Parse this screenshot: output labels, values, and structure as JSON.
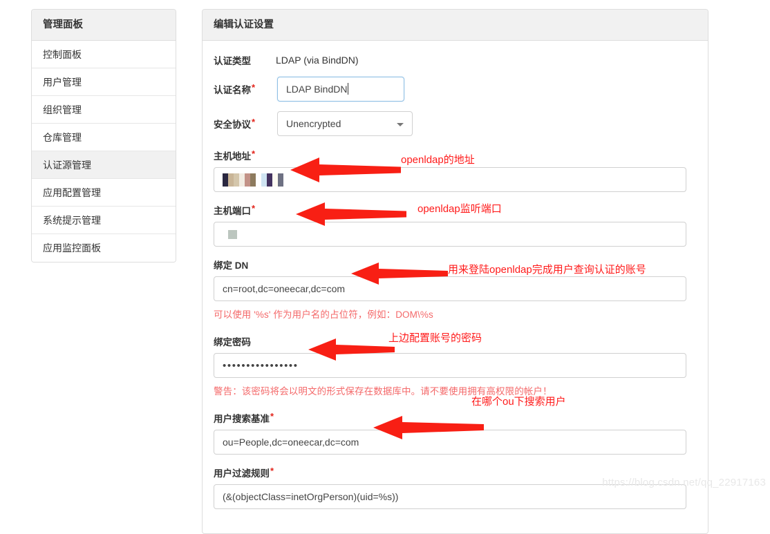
{
  "sidebar": {
    "header": "管理面板",
    "items": [
      {
        "label": "控制面板",
        "active": false
      },
      {
        "label": "用户管理",
        "active": false
      },
      {
        "label": "组织管理",
        "active": false
      },
      {
        "label": "仓库管理",
        "active": false
      },
      {
        "label": "认证源管理",
        "active": true
      },
      {
        "label": "应用配置管理",
        "active": false
      },
      {
        "label": "系统提示管理",
        "active": false
      },
      {
        "label": "应用监控面板",
        "active": false
      }
    ]
  },
  "panel": {
    "header": "编辑认证设置",
    "auth_type": {
      "label": "认证类型",
      "value": "LDAP (via BindDN)"
    },
    "auth_name": {
      "label": "认证名称",
      "required": true,
      "value": "LDAP BindDN",
      "focused": true
    },
    "security_protocol": {
      "label": "安全协议",
      "required": true,
      "value": "Unencrypted"
    },
    "host_address": {
      "label": "主机地址",
      "required": true,
      "value": "",
      "redacted": true
    },
    "host_port": {
      "label": "主机端口",
      "required": true,
      "value": "",
      "redacted": true
    },
    "bind_dn": {
      "label": "绑定 DN",
      "required": false,
      "value": "cn=root,dc=oneecar,dc=com",
      "help": "可以使用 '%s' 作为用户名的占位符，例如：DOM\\%s"
    },
    "bind_password": {
      "label": "绑定密码",
      "required": false,
      "value": "••••••••••••••••",
      "warning": "警告：该密码将会以明文的形式保存在数据库中。请不要使用拥有高权限的帐户！"
    },
    "user_search_base": {
      "label": "用户搜索基准",
      "required": true,
      "value": "ou=People,dc=oneecar,dc=com"
    },
    "user_filter": {
      "label": "用户过滤规则",
      "required": true,
      "value": "(&(objectClass=inetOrgPerson)(uid=%s))"
    }
  },
  "annotations": {
    "host_address": "openldap的地址",
    "host_port": "openldap监听端口",
    "bind_dn": "用来登陆openldap完成用户查询认证的账号",
    "bind_password": "上边配置账号的密码",
    "user_search_base": "在哪个ou下搜索用户"
  },
  "watermark": "https://blog.csdn.net/qq_22917163",
  "colors": {
    "annotation_red": "#ff1a1a",
    "help_red": "#f4696a",
    "required_red": "#e2231a",
    "focus_blue": "#8ebfe4",
    "header_bg": "#f1f1f1",
    "border": "#dddddd"
  }
}
